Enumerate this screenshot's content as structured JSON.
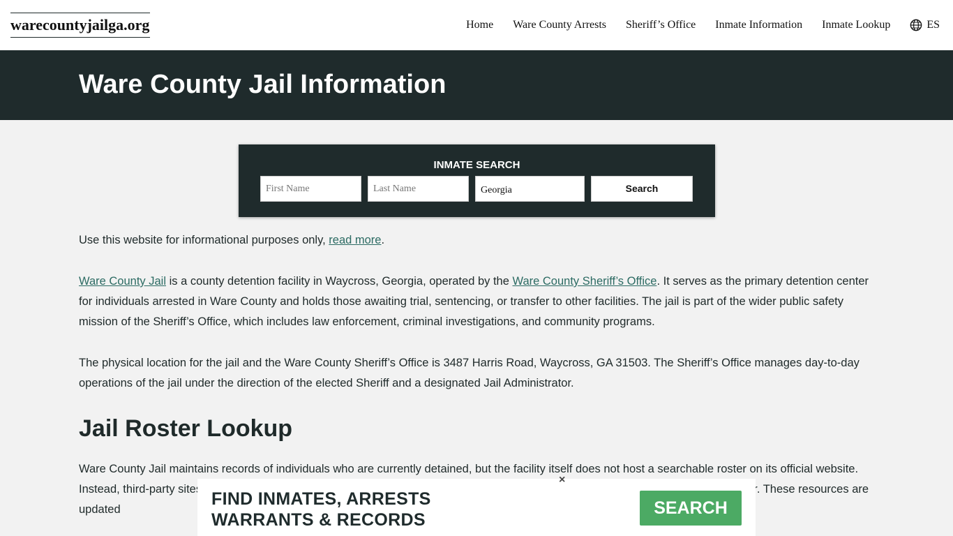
{
  "header": {
    "logo": "warecountyjailga.org",
    "nav": [
      "Home",
      "Ware County Arrests",
      "Sheriff’s Office",
      "Inmate Information",
      "Inmate Lookup"
    ],
    "lang": "ES",
    "lang_icon": "globe-icon"
  },
  "hero": {
    "title": "Ware County Jail Information"
  },
  "search": {
    "title": "INMATE SEARCH",
    "first_placeholder": "First Name",
    "last_placeholder": "Last Name",
    "state_value": "Georgia",
    "button": "Search"
  },
  "content": {
    "p1_text": "Use this website for informational purposes only, ",
    "p1_link": "read more",
    "p1_end": ".",
    "p2_link1": "Ware County Jail",
    "p2_mid": " is a county detention facility in Waycross, Georgia, operated by the ",
    "p2_link2": "Ware County Sheriff’s Office",
    "p2_rest": ". It serves as the primary detention center for individuals arrested in Ware County and holds those awaiting trial, sentencing, or transfer to other facilities. The jail is part of the wider public safety mission of the Sheriff’s Office, which includes law enforcement, criminal investigations, and community programs.",
    "p3": "The physical location for the jail and the Ware County Sheriff’s Office is 3487 Harris Road, Waycross, GA 31503. The Sheriff’s Office manages day-to-day operations of the jail under the direction of the elected Sheriff and a designated Jail Administrator.",
    "h2": "Jail Roster Lookup",
    "p4": "Ware County Jail maintains records of individuals who are currently detained, but the facility itself does not host a searchable roster on its official website. Instead, third-party sites and services provide access to the jail roster and detainee information that is collected from the official roster. These resources are updated"
  },
  "ad": {
    "line1": "FIND INMATES, ARRESTS",
    "line2": "WARRANTS & RECORDS",
    "button": "SEARCH",
    "close": "×",
    "button_color": "#4caa64"
  },
  "colors": {
    "dark": "#1f2b2c",
    "link": "#2c6b63",
    "background": "#f2f2f2"
  }
}
